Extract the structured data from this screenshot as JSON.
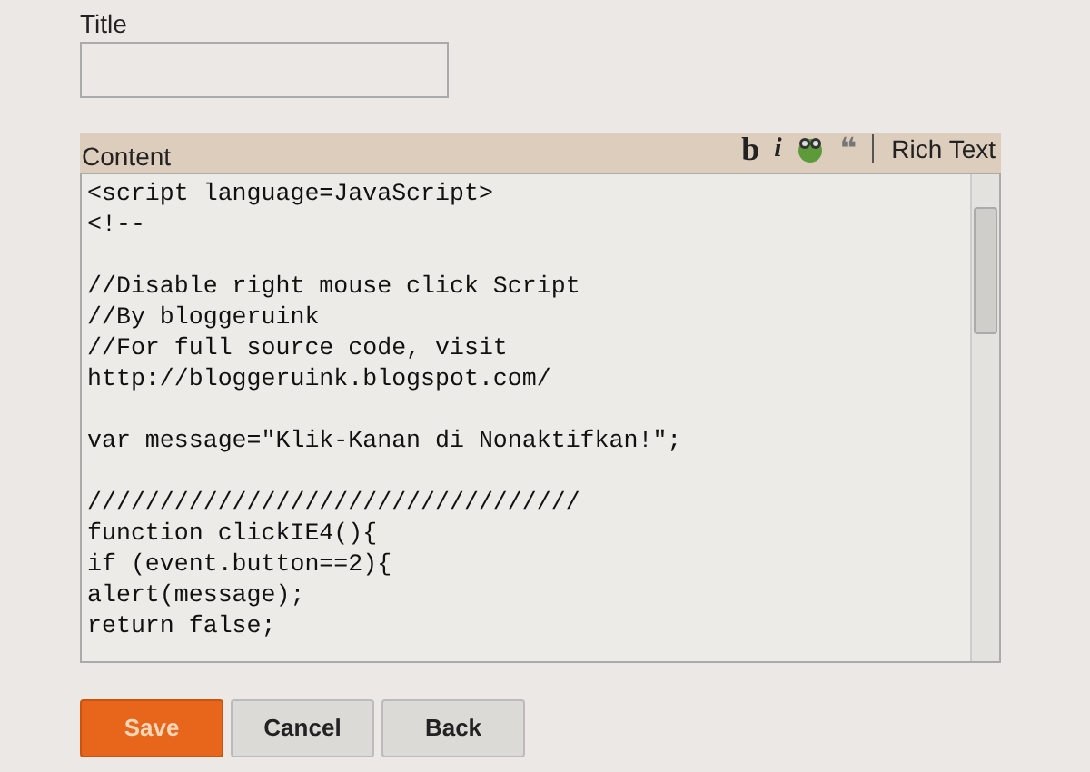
{
  "title_field": {
    "label": "Title"
  },
  "content": {
    "label": "Content",
    "toolbar": [
      {
        "kind": "bold",
        "text": "b"
      },
      {
        "kind": "italic",
        "text": "i"
      },
      {
        "kind": "image"
      },
      {
        "kind": "quote",
        "text": "❝"
      }
    ],
    "mode_link": "Rich Text",
    "lines": [
      {
        "kind": "code",
        "text": "<script language=JavaScript>"
      },
      {
        "kind": "code",
        "text": "<!--"
      },
      {
        "kind": "blank"
      },
      {
        "kind": "code",
        "text": "//Disable right mouse click Script"
      },
      {
        "kind": "code",
        "text": "//By bloggeruink"
      },
      {
        "kind": "code",
        "text": "//For full source code, visit"
      },
      {
        "kind": "code",
        "text": "http://bloggeruink.blogspot.com/"
      },
      {
        "kind": "blank"
      },
      {
        "kind": "code",
        "text": "var message=\"Klik-Kanan di Nonaktifkan!\";"
      },
      {
        "kind": "blank"
      },
      {
        "kind": "code",
        "text": "//////////////////////////////////"
      },
      {
        "kind": "code",
        "text": "function clickIE4(){"
      },
      {
        "kind": "code",
        "text": "if (event.button==2){"
      },
      {
        "kind": "code",
        "text": "alert(message);"
      },
      {
        "kind": "code",
        "text": "return false;"
      }
    ]
  },
  "buttons": [
    {
      "label": "Save",
      "kind": "primary"
    },
    {
      "label": "Cancel",
      "kind": "default"
    },
    {
      "label": "Back",
      "kind": "default"
    }
  ]
}
